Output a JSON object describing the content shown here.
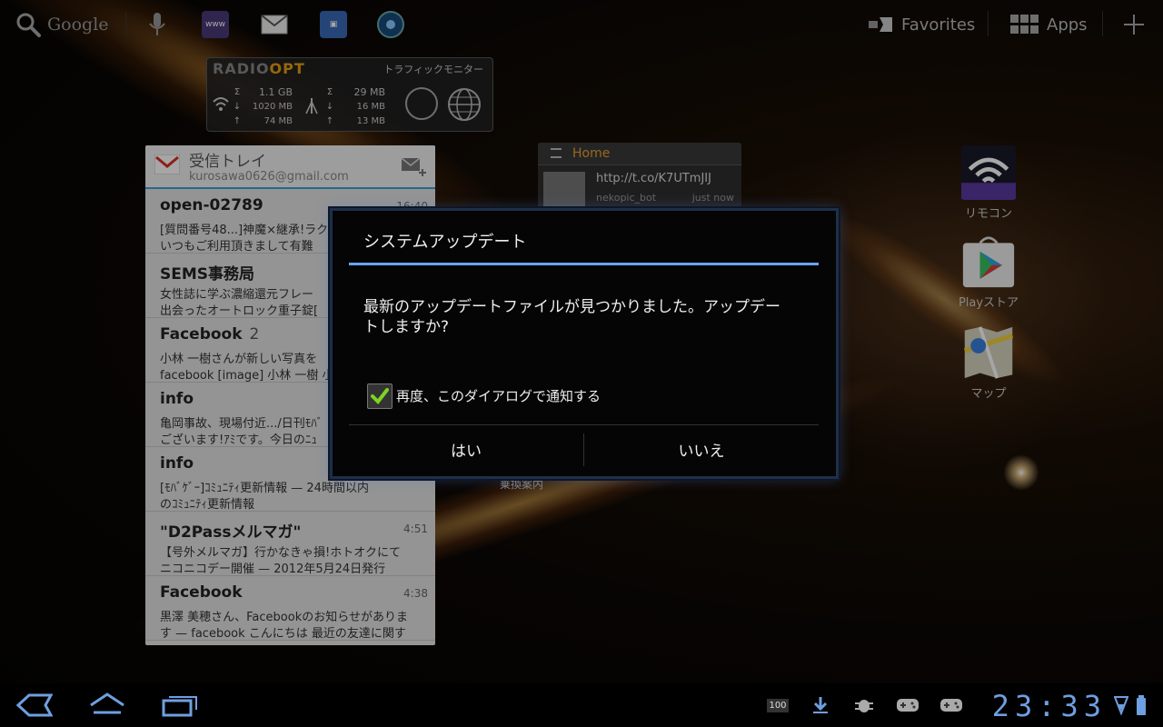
{
  "topbar": {
    "google_label": "Google",
    "favorites_label": "Favorites",
    "apps_label": "Apps"
  },
  "radiopt_widget": {
    "logo_main": "RADIO",
    "logo_accent": "OPT",
    "title": "トラフィックモニター",
    "wifi": {
      "sigma": "Σ",
      "total": "1.1 GB",
      "down": "1020 MB",
      "up": "74 MB"
    },
    "mobile": {
      "sigma": "Σ",
      "total": "29 MB",
      "down": "16 MB",
      "up": "13 MB"
    }
  },
  "gmail_widget": {
    "title": "受信トレイ",
    "account": "kurosawa0626@gmail.com",
    "mails": [
      {
        "from": "open-02789",
        "count": "",
        "time": "16:40",
        "line1": "[質問番号48...]神魔×継承!ラク",
        "line2": "いつもご利用頂きまして有難"
      },
      {
        "from": "SEMS事務局",
        "count": "",
        "time": "",
        "line1": "女性誌に学ぶ濃縮還元フレー",
        "line2": "出会ったオートロック重子錠["
      },
      {
        "from": "Facebook",
        "count": "2",
        "time": "",
        "line1": "小林 一樹さんが新しい写真を",
        "line2": "facebook [image] 小林 一樹 小"
      },
      {
        "from": "info",
        "count": "",
        "time": "",
        "line1": "亀岡事故、現場付近.../日刊ﾓﾊﾞ",
        "line2": "ございます!ｱﾐです。今日のﾆｭ"
      },
      {
        "from": "info",
        "count": "",
        "time": "",
        "line1": "[ﾓﾊﾞｹﾞｰ]ｺﾐｭﾆﾃｨ更新情報 — 24時間以内",
        "line2": "のｺﾐｭﾆﾃｨ更新情報"
      },
      {
        "from": "\"D2Passメルマガ\"",
        "count": "",
        "time": "4:51",
        "line1": "【号外メルマガ】行かなきゃ損!ホトオクにて",
        "line2": "ニコニコデー開催 — 2012年5月24日発行"
      },
      {
        "from": "Facebook",
        "count": "",
        "time": "4:38",
        "line1": "黒澤 美穂さん、Facebookのお知らせがありま",
        "line2": "す — facebook こんにちは 最近の友達に関す"
      }
    ]
  },
  "twitter_widget": {
    "header": "Home",
    "url": "http://t.co/K7UTmJIJ",
    "user": "nekopic_bot",
    "when": "just now"
  },
  "norikae_label": "乗換案内",
  "desktop_icons": {
    "remote": "リモコン",
    "play": "Playストア",
    "maps": "マップ"
  },
  "dialog": {
    "title": "システムアップデート",
    "message": "最新のアップデートファイルが見つかりました。アップデートしますか?",
    "checkbox_label": "再度、このダイアログで通知する",
    "checkbox_checked": true,
    "yes_label": "はい",
    "no_label": "いいえ"
  },
  "statusbar": {
    "battery_icon_text": "100",
    "clock": "23:33"
  },
  "colors": {
    "accent_blue": "#6ea2ee",
    "clock_blue": "#6f9fe0",
    "check_green": "#7ed321",
    "radiopt_orange": "#e8a010"
  }
}
